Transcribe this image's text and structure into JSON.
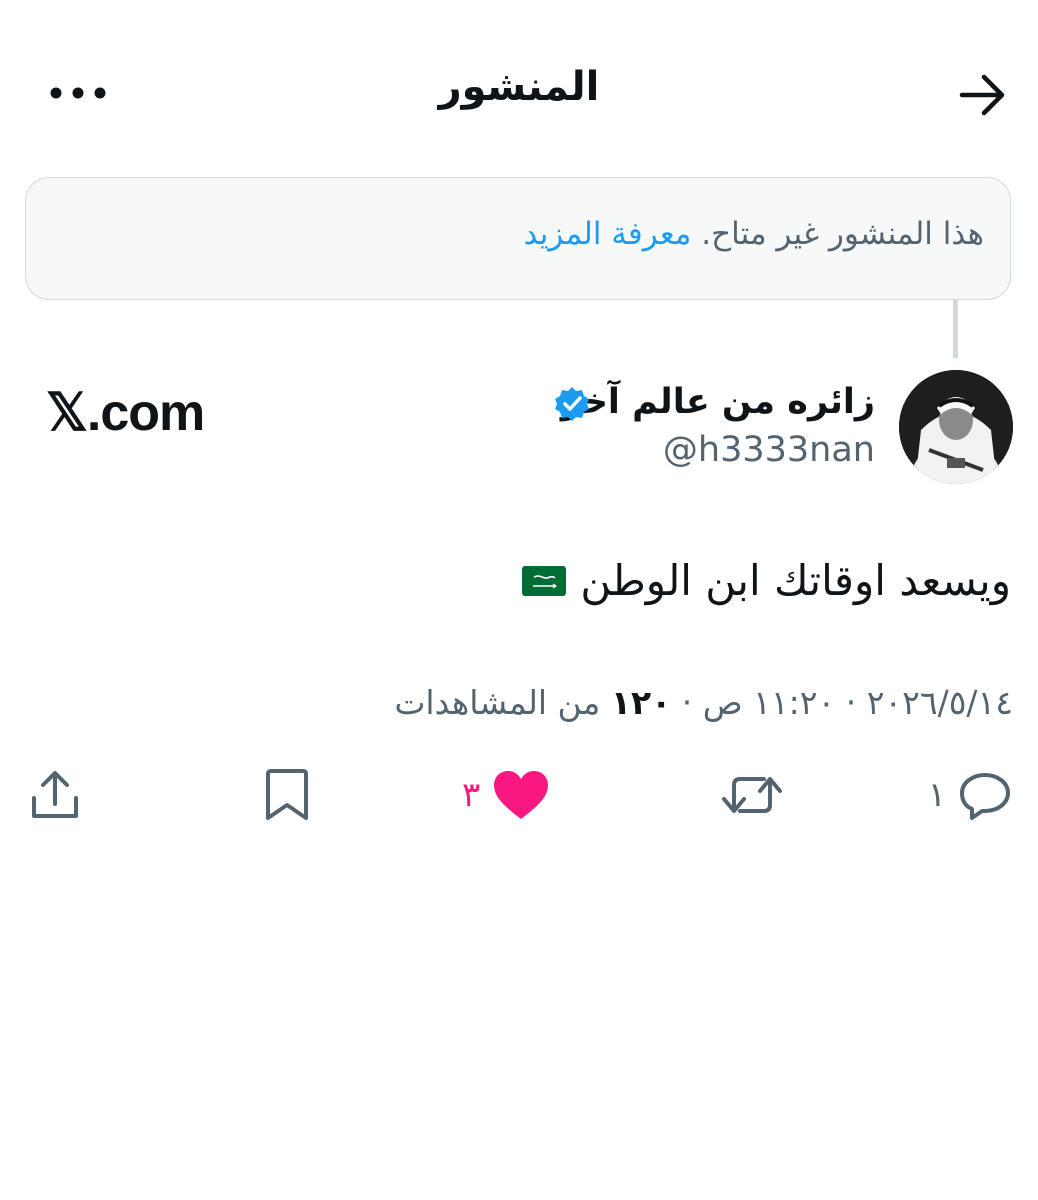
{
  "header": {
    "title": "المنشور",
    "back_icon": "arrow-right-icon",
    "more_icon": "more-horizontal-icon"
  },
  "notice": {
    "text": "هذا المنشور غير متاح.",
    "link": "معرفة المزيد"
  },
  "author": {
    "name": "زائره من عالم آخر",
    "handle": "@h3333nan",
    "verified": true
  },
  "watermark": "𝕏.com",
  "post": {
    "text": "ويسعد اوقاتك ابن الوطن",
    "flag_icon": "saudi-flag-icon",
    "timestamp": "٢٠٢٦/٥/١٤ · ١١:٢٠ ص",
    "views_count": "١٢٠",
    "views_label": "من المشاهدات"
  },
  "actions": {
    "reply_count": "١",
    "like_count": "٣",
    "colors": {
      "like": "#f91880",
      "link": "#1d9bf0",
      "verified": "#1d9bf0",
      "muted": "#536471"
    }
  }
}
